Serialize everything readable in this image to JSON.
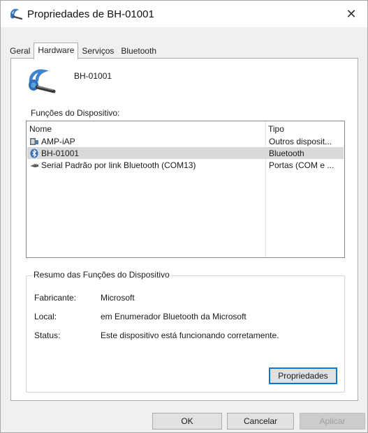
{
  "window": {
    "title": "Propriedades de BH-01001",
    "close_label": "✕"
  },
  "tabs": [
    {
      "label": "Geral",
      "active": false
    },
    {
      "label": "Hardware",
      "active": true
    },
    {
      "label": "Serviços",
      "active": false
    },
    {
      "label": "Bluetooth",
      "active": false
    }
  ],
  "device": {
    "name": "BH-01001",
    "icon": "bluetooth-headset-icon"
  },
  "functions": {
    "label": "Funções do Dispositivo:",
    "columns": [
      "Nome",
      "Tipo"
    ],
    "rows": [
      {
        "name": "AMP-iAP",
        "type": "Outros disposit...",
        "icon": "device-icon",
        "selected": false
      },
      {
        "name": "BH-01001",
        "type": "Bluetooth",
        "icon": "bluetooth-icon",
        "selected": true
      },
      {
        "name": "Serial Padrão por link Bluetooth (COM13)",
        "type": "Portas (COM e ...",
        "icon": "port-icon",
        "selected": false
      }
    ]
  },
  "summary": {
    "title": "Resumo das Funções do Dispositivo",
    "fields": [
      {
        "key": "Fabricante:",
        "value": "Microsoft"
      },
      {
        "key": "Local:",
        "value": "em Enumerador Bluetooth da Microsoft"
      },
      {
        "key": "Status:",
        "value": "Este dispositivo está funcionando corretamente."
      }
    ],
    "properties_button": "Propriedades"
  },
  "footer": {
    "ok": "OK",
    "cancel": "Cancelar",
    "apply": "Aplicar"
  },
  "colors": {
    "accent": "#0078d7",
    "selection": "#d9d9d9",
    "bluetooth": "#2f6fb8"
  }
}
